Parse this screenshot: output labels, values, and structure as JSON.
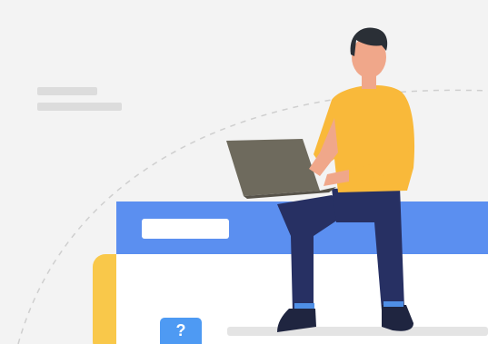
{
  "illustration": {
    "help_badge": "?",
    "colors": {
      "background": "#f3f3f3",
      "window_header": "#5b8ff0",
      "window_body": "#ffffff",
      "accent_yellow": "#f9c84a",
      "help_badge": "#4e9af3",
      "shirt": "#f9b93a",
      "pants": "#273063",
      "laptop": "#6e6a5d",
      "hair": "#2a2f36",
      "skin": "#f0a78a"
    },
    "icons": [
      "help-icon",
      "laptop-icon"
    ]
  }
}
